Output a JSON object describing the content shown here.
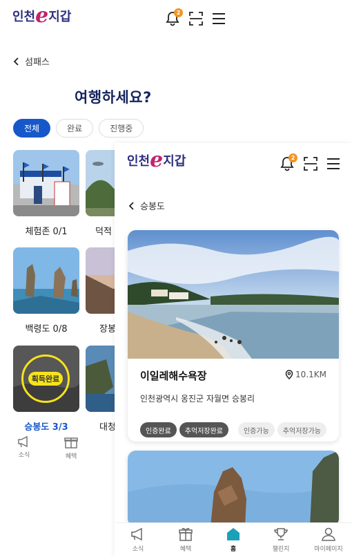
{
  "brand": {
    "logo_left": "인천",
    "logo_e": "e",
    "logo_right": "지갑",
    "accent": "#1658c9",
    "navy": "#14245e",
    "logo_pink": "#c2246b"
  },
  "header": {
    "notification_count": "2",
    "icons": [
      "bell-icon",
      "qr-scan-icon",
      "menu-icon"
    ]
  },
  "back_screen": {
    "breadcrumb": "섬패스",
    "title": "여행하세요?",
    "filters": [
      {
        "label": "전체",
        "active": true
      },
      {
        "label": "완료",
        "active": false
      },
      {
        "label": "진행중",
        "active": false
      }
    ],
    "cards": [
      {
        "label": "체험존 0/1"
      },
      {
        "label": "덕적"
      },
      {
        "label": "백령도 0/8"
      },
      {
        "label": "장봉"
      },
      {
        "label": "승봉도 3/3",
        "badge": "획득완료",
        "highlight": true
      },
      {
        "label": "대청"
      }
    ],
    "nav": [
      {
        "label": "소식",
        "icon": "megaphone-icon"
      },
      {
        "label": "혜택",
        "icon": "gift-icon"
      }
    ]
  },
  "front_screen": {
    "breadcrumb": "승봉도",
    "place": {
      "name": "이일레해수욕장",
      "distance": "10.1KM",
      "address": "인천광역시 옹진군 자월면 승봉리",
      "tags_status": [
        "인증완료",
        "추억저장완료"
      ],
      "tags_available": [
        "인증가능",
        "추억저장가능"
      ]
    },
    "nav": [
      {
        "label": "소식",
        "icon": "megaphone-icon"
      },
      {
        "label": "혜택",
        "icon": "gift-icon"
      },
      {
        "label": "홈",
        "icon": "home-icon",
        "active": true
      },
      {
        "label": "챌린지",
        "icon": "trophy-icon"
      },
      {
        "label": "마이페이지",
        "icon": "person-icon"
      }
    ]
  }
}
